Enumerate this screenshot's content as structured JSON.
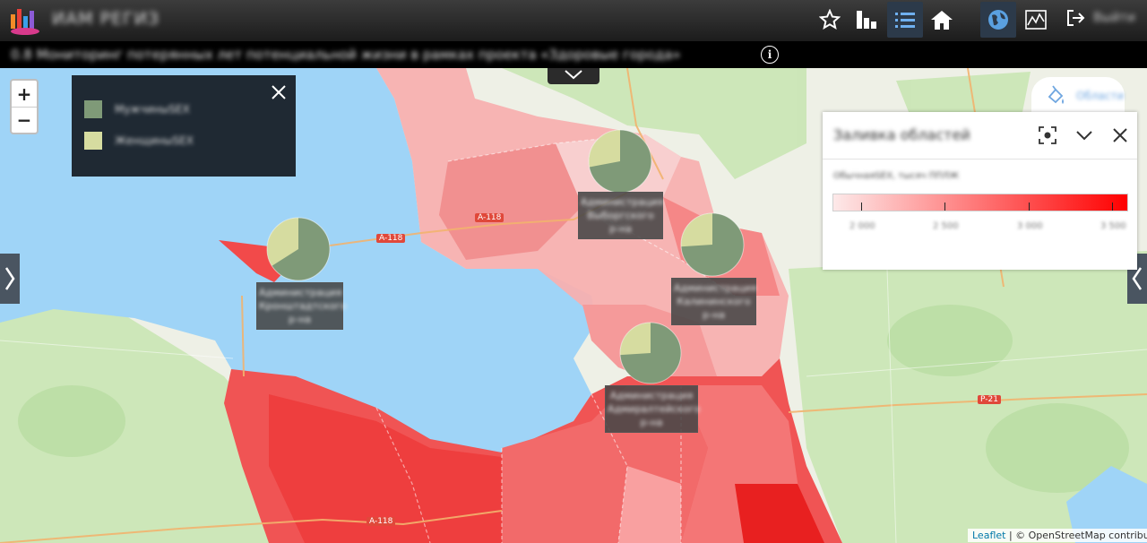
{
  "app": {
    "title": "ИАМ РЕГИЗ",
    "subtitle": "0.8 Мониторинг потерянных лет потенциальной жизни в рамках проекта «Здоровые города»",
    "logout_label": "Выйти"
  },
  "toolbar": {
    "icons": [
      "star-icon",
      "bar-chart-icon",
      "list-icon",
      "home-icon",
      "globe-icon",
      "line-chart-icon",
      "logout-icon"
    ]
  },
  "legend": {
    "items": [
      {
        "label": "МужчиныSEX",
        "color": "#7f9a78"
      },
      {
        "label": "ЖенщиныSEX",
        "color": "#d6dca0"
      }
    ]
  },
  "pies": [
    {
      "label_lines": [
        "Администрация",
        "Выборгского",
        "р-на"
      ],
      "male_share": 0.72
    },
    {
      "label_lines": [
        "Администрация",
        "Кронштадтского",
        "р-на"
      ],
      "male_share": 0.66
    },
    {
      "label_lines": [
        "Администрация",
        "Калининского",
        "р-на"
      ],
      "male_share": 0.74
    },
    {
      "label_lines": [
        "Администрация",
        "Адмиралтейского",
        "р-на"
      ],
      "male_share": 0.74
    }
  ],
  "map_labels": {
    "road_a118_1": "A-118",
    "road_a118_2": "A-118",
    "road_a118_3": "A-118",
    "road_r21": "P-21"
  },
  "fill_panel": {
    "tab_label": "Области",
    "title": "Заливка областей",
    "indicator": "ОбычнаяSEX, тысяч ППЛЖ",
    "ticks": [
      "2 000",
      "2 500",
      "3 000",
      "3 500"
    ],
    "gradient_from": "#fde9e9",
    "gradient_to": "#ff0000"
  },
  "attribution": {
    "leaflet": "Leaflet",
    "rest": "| © OpenStreetMap contributors"
  },
  "colors": {
    "sea": "#9fd4f7",
    "land": "#eef0e6",
    "forest": "#c9e6b4",
    "male": "#7f9a78",
    "female": "#d6dca0"
  }
}
